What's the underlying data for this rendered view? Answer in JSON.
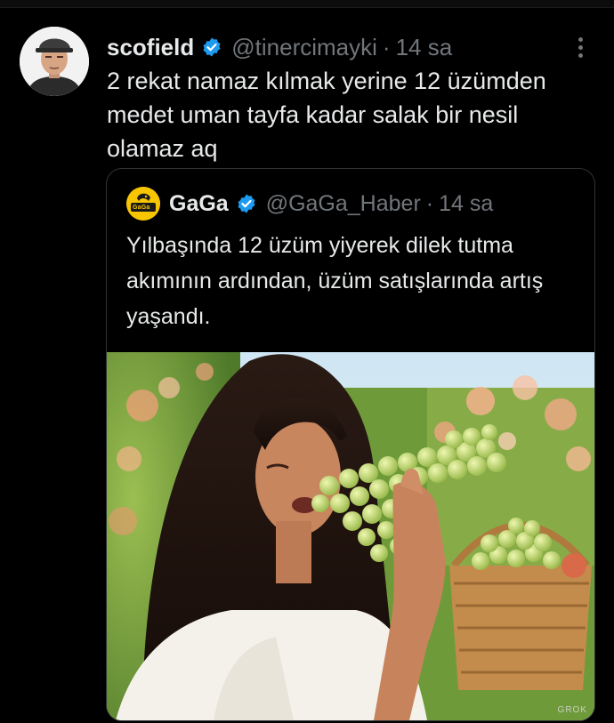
{
  "tweet": {
    "name": "scofield",
    "handle": "@tinercimayki",
    "separator": "·",
    "time": "14 sa",
    "text": "2 rekat namaz kılmak yerine 12 üzümden medet uman tayfa kadar salak bir nesil olamaz aq",
    "verified_color": "#1d9bf0"
  },
  "quote": {
    "name": "GaGa",
    "handle": "@GaGa_Haber",
    "separator": "·",
    "time": "14 sa",
    "text": "Yılbaşında 12 üzüm yiyerek dilek tutma akımının ardından, üzüm satışlarında artış yaşandı.",
    "avatar_logo": "GaGa",
    "avatar_color": "#f7c600"
  },
  "image": {
    "watermark": "GROK",
    "description_icon": "photo"
  },
  "colors": {
    "background": "#000000",
    "text": "#e7e9ea",
    "muted": "#71767b",
    "border": "#2f3336"
  }
}
